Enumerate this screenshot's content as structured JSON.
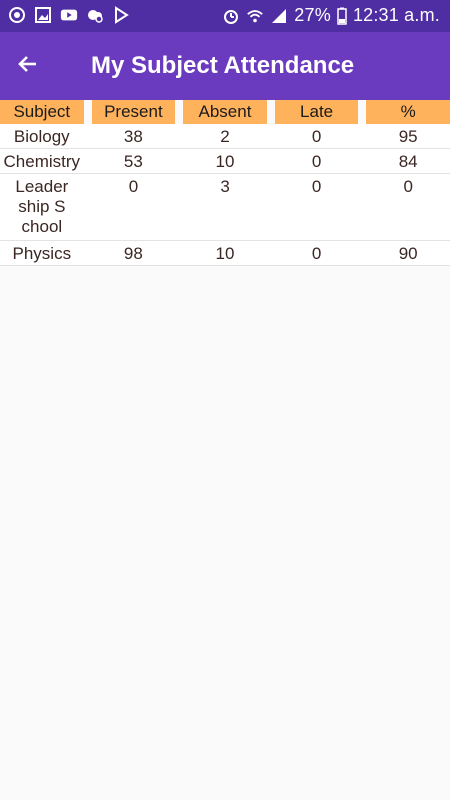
{
  "status_bar": {
    "battery_percent": "27%",
    "time": "12:31 a.m.",
    "left_icons": [
      "sync-icon",
      "image-icon",
      "youtube-icon",
      "cloud-icon",
      "play-store-icon"
    ],
    "right_icons": [
      "alarm-icon",
      "wifi-icon",
      "signal-icon",
      "battery-icon"
    ]
  },
  "app_bar": {
    "title": "My Subject Attendance",
    "back_icon": "arrow-left-icon"
  },
  "table": {
    "headers": [
      "Subject",
      "Present",
      "Absent",
      "Late",
      "%"
    ],
    "rows": [
      {
        "subject": "Biology",
        "present": "38",
        "absent": "2",
        "late": "0",
        "percent": "95"
      },
      {
        "subject": "Chemistry",
        "present": "53",
        "absent": "10",
        "late": "0",
        "percent": "84"
      },
      {
        "subject": "Leadership School",
        "present": "0",
        "absent": "3",
        "late": "0",
        "percent": "0"
      },
      {
        "subject": "Physics",
        "present": "98",
        "absent": "10",
        "late": "0",
        "percent": "90"
      }
    ]
  },
  "colors": {
    "status_bar": "#4f2ea3",
    "app_bar": "#6a3bbf",
    "header_cell": "#ffb25c",
    "background": "#fafafa"
  }
}
